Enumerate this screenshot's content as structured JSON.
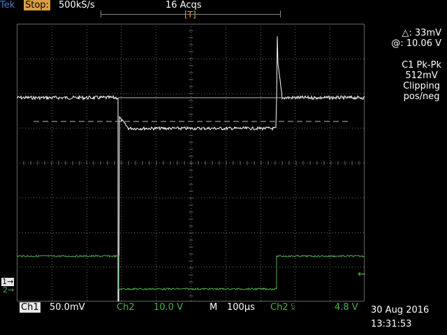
{
  "header": {
    "brand": "Tek",
    "state": "Stop:",
    "sample_rate": "500kS/s",
    "acquisitions": "16 Acqs",
    "trigger_marker": "[T]"
  },
  "cursor": {
    "delta": "△: 33mV",
    "at": "@: 10.06 V"
  },
  "measurement": {
    "line1": "C1 Pk-Pk",
    "line2": "512mV",
    "line3": "Clipping",
    "line4": "pos/neg"
  },
  "footer": {
    "ch1_label": "Ch1",
    "ch1_scale": "50.0mV",
    "ch2_label": "Ch2",
    "ch2_scale": "10.0 V",
    "timebase_label": "M",
    "timebase": "100µs",
    "trigger_source": "Ch2 ⫁",
    "trigger_level": "4.8 V",
    "date": "30 Aug 2016",
    "time": "13:31:53"
  },
  "markers": {
    "ch1": "1→",
    "ch2": "2→",
    "trigger_arrow": "←"
  },
  "colors": {
    "ch1": "#ffffff",
    "ch2": "#4caf50",
    "grid": "#666666",
    "cursor": "#bbbbbb"
  }
}
